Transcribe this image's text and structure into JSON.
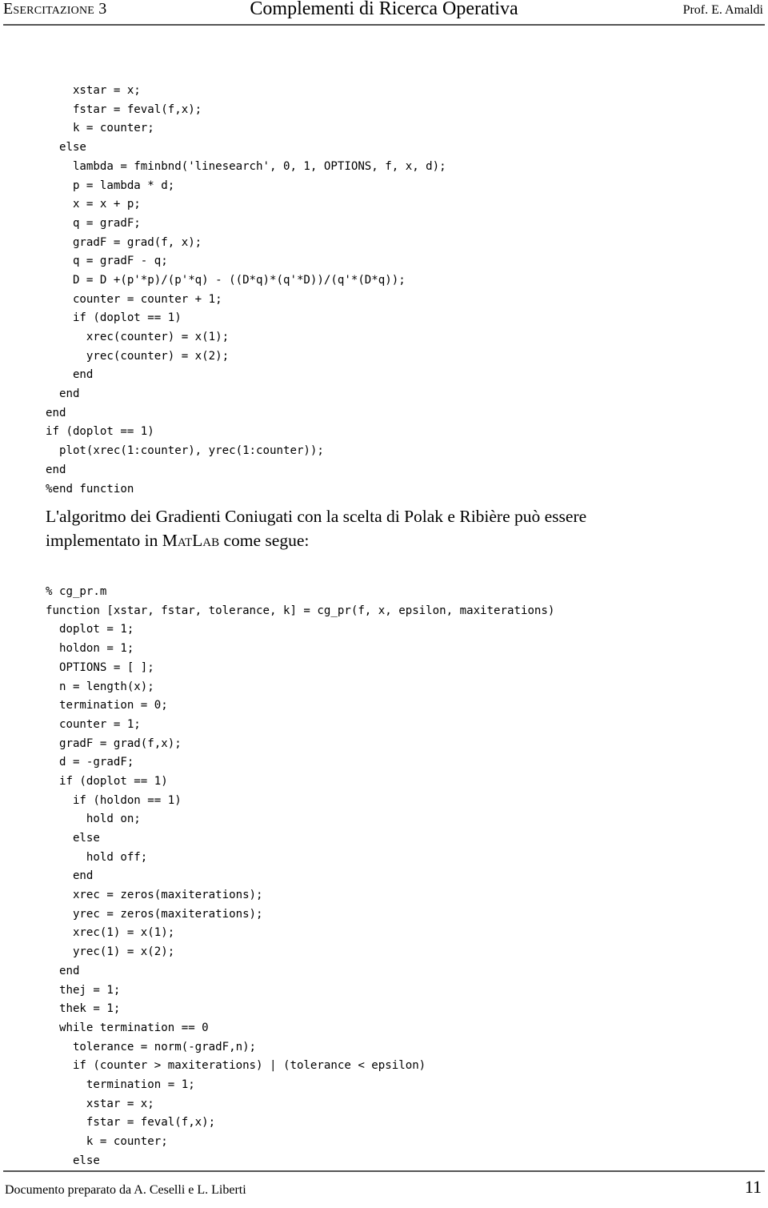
{
  "header": {
    "left": "Esercitazione 3",
    "center": "Complementi di Ricerca Operativa",
    "right": "Prof. E. Amaldi"
  },
  "code_block_1": {
    "name": "bfgs-tail-listing",
    "lines": [
      "    xstar = x;",
      "    fstar = feval(f,x);",
      "    k = counter;",
      "  else",
      "    lambda = fminbnd('linesearch', 0, 1, OPTIONS, f, x, d);",
      "    p = lambda * d;",
      "    x = x + p;",
      "    q = gradF;",
      "    gradF = grad(f, x);",
      "    q = gradF - q;",
      "    D = D +(p'*p)/(p'*q) - ((D*q)*(q'*D))/(q'*(D*q));",
      "    counter = counter + 1;",
      "    if (doplot == 1)",
      "      xrec(counter) = x(1);",
      "      yrec(counter) = x(2);",
      "    end",
      "  end",
      "end",
      "if (doplot == 1)",
      "  plot(xrec(1:counter), yrec(1:counter));",
      "end",
      "%end function"
    ]
  },
  "prose": {
    "line1_left": "L'algoritmo dei Gradienti Coniugati con la scelta di Polak e Ribière può essere",
    "line2_before": "implementato in ",
    "line2_smallcaps": "MatLab",
    "line2_after": " come segue:"
  },
  "code_block_2": {
    "name": "cg-pr-listing",
    "lines": [
      "% cg_pr.m",
      "function [xstar, fstar, tolerance, k] = cg_pr(f, x, epsilon, maxiterations)",
      "  doplot = 1;",
      "  holdon = 1;",
      "  OPTIONS = [ ];",
      "  n = length(x);",
      "  termination = 0;",
      "  counter = 1;",
      "  gradF = grad(f,x);",
      "  d = -gradF;",
      "  if (doplot == 1)",
      "    if (holdon == 1)",
      "      hold on;",
      "    else",
      "      hold off;",
      "    end",
      "    xrec = zeros(maxiterations);",
      "    yrec = zeros(maxiterations);",
      "    xrec(1) = x(1);",
      "    yrec(1) = x(2);",
      "  end",
      "  thej = 1;",
      "  thek = 1;",
      "  while termination == 0",
      "    tolerance = norm(-gradF,n);",
      "    if (counter > maxiterations) | (tolerance < epsilon)",
      "      termination = 1;",
      "      xstar = x;",
      "      fstar = feval(f,x);",
      "      k = counter;",
      "    else"
    ]
  },
  "footer": {
    "left": "Documento preparato da A. Ceselli e L. Liberti",
    "page_number": "11"
  },
  "colors": {
    "text": "#000000",
    "rule": "#555555",
    "background": "#ffffff"
  }
}
